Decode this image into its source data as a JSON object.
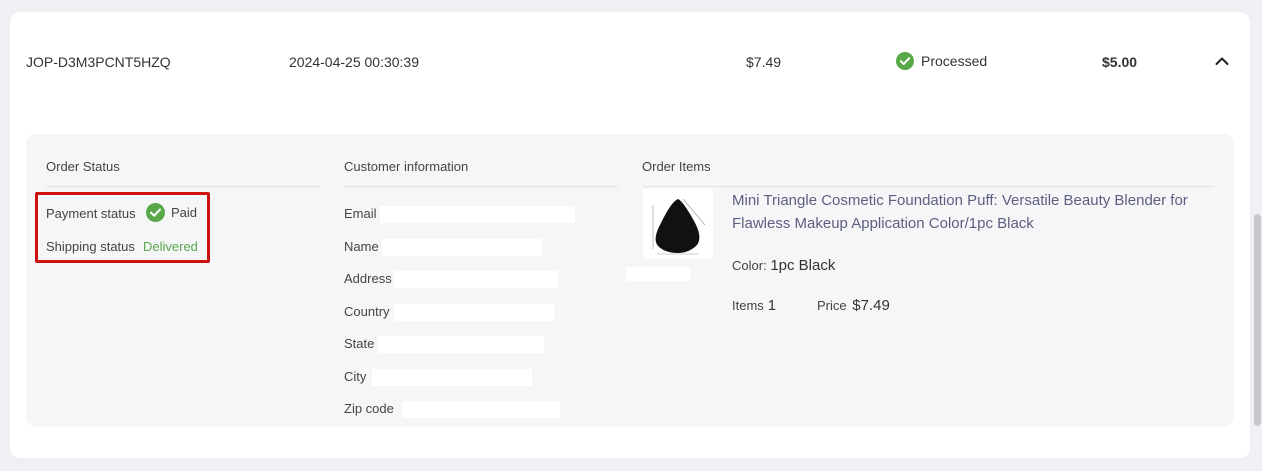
{
  "order": {
    "id": "JOP-D3M3PCNT5HZQ",
    "date": "2024-04-25 00:30:39",
    "amount": "$7.49",
    "status": "Processed",
    "total": "$5.00"
  },
  "details": {
    "order_status": {
      "title": "Order Status",
      "payment_label": "Payment status",
      "payment_value": "Paid",
      "shipping_label": "Shipping status",
      "shipping_value": "Delivered"
    },
    "customer": {
      "title": "Customer information",
      "fields": [
        "Email",
        "Name",
        "Address",
        "Country",
        "State",
        "City",
        "Zip code"
      ]
    },
    "items": {
      "title": "Order Items",
      "product_title": "Mini Triangle Cosmetic Foundation Puff: Versatile Beauty Blender for Flawless Makeup Application Color/1pc Black",
      "color_label": "Color:",
      "color_value": "1pc Black",
      "items_label": "Items",
      "items_value": "1",
      "price_label": "Price",
      "price_value": "$7.49"
    }
  },
  "colors": {
    "accent_green": "#58a84a",
    "highlight_red": "#cc1111",
    "link_blue_gray": "#5c5f80"
  }
}
